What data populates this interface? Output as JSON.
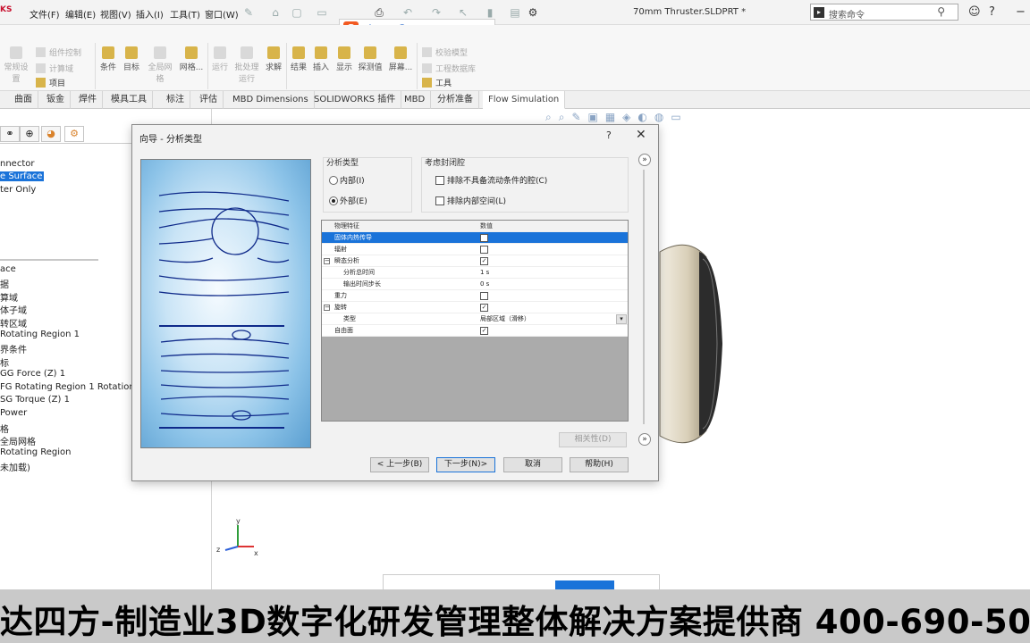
{
  "app": {
    "brand": "KS",
    "document_title": "70mm Thruster.SLDPRT *"
  },
  "menu": [
    "文件(F)",
    "编辑(E)",
    "视图(V)",
    "插入(I)",
    "工具(T)",
    "窗口(W)"
  ],
  "search": {
    "placeholder": "搜索命令"
  },
  "ime": {
    "label": "中"
  },
  "ribbon": {
    "items": [
      {
        "label": "常规设置",
        "dim": true
      },
      {
        "label": "条件",
        "dim": false
      },
      {
        "label": "目标",
        "dim": false
      },
      {
        "label": "全局网格",
        "dim": true
      },
      {
        "label": "网格...",
        "dim": false
      },
      {
        "label": "运行",
        "dim": true
      },
      {
        "label": "批处理运行",
        "dim": true
      },
      {
        "label": "求解",
        "dim": false
      },
      {
        "label": "结果",
        "dim": false
      },
      {
        "label": "插入",
        "dim": false
      },
      {
        "label": "显示",
        "dim": false
      },
      {
        "label": "探测值",
        "dim": false
      },
      {
        "label": "屏幕...",
        "dim": false
      }
    ],
    "rows": [
      "组件控制",
      "计算域",
      "项目",
      "校验模型",
      "工程数据库",
      "工具"
    ]
  },
  "tabs": [
    {
      "label": "曲面",
      "active": false
    },
    {
      "label": "钣金",
      "active": false
    },
    {
      "label": "焊件",
      "active": false
    },
    {
      "label": "模具工具",
      "active": false
    },
    {
      "label": "标注",
      "active": false
    },
    {
      "label": "评估",
      "active": false
    },
    {
      "label": "MBD Dimensions",
      "active": false
    },
    {
      "label": "SOLIDWORKS 插件",
      "active": false
    },
    {
      "label": "MBD",
      "active": false
    },
    {
      "label": "分析准备",
      "active": false
    },
    {
      "label": "Flow Simulation",
      "active": true
    }
  ],
  "tree": {
    "top_items": [
      {
        "label": "nnector",
        "selected": false
      },
      {
        "label": "e Surface",
        "selected": true
      },
      {
        "label": "ter Only",
        "selected": false
      }
    ],
    "items": [
      "ace",
      "据",
      "算域",
      "体子域",
      "转区域",
      "Rotating Region 1",
      "界条件",
      "标",
      "GG Force (Z) 1",
      "FG Rotating Region 1 Rotation",
      "SG Torque (Z) 1",
      "Power",
      "格",
      "全局网格",
      "Rotating Region",
      "未加载)"
    ]
  },
  "wizard": {
    "title": "向导 - 分析类型",
    "help": "?",
    "analysis_type": {
      "label": "分析类型",
      "options": [
        {
          "label": "内部(I)",
          "selected": false
        },
        {
          "label": "外部(E)",
          "selected": true
        }
      ]
    },
    "closed_cavities": {
      "label": "考虑封闭腔",
      "options": [
        {
          "label": "排除不具备流动条件的腔(C)",
          "checked": false
        },
        {
          "label": "排除内部空间(L)",
          "checked": false
        }
      ]
    },
    "table": {
      "header": {
        "name": "物理特征",
        "value": "数值"
      },
      "rows": [
        {
          "name": "固体内热传导",
          "value": "",
          "checkbox": true,
          "checked": false,
          "selected": true,
          "toggle": "",
          "indent": 0,
          "dropdown": false
        },
        {
          "name": "辐射",
          "value": "",
          "checkbox": true,
          "checked": false,
          "selected": false,
          "toggle": "",
          "indent": 0,
          "dropdown": false
        },
        {
          "name": "瞬态分析",
          "value": "",
          "checkbox": true,
          "checked": true,
          "selected": false,
          "toggle": "−",
          "indent": 0,
          "dropdown": false
        },
        {
          "name": "分析总时间",
          "value": "1 s",
          "checkbox": false,
          "checked": false,
          "selected": false,
          "toggle": "",
          "indent": 1,
          "dropdown": false
        },
        {
          "name": "输出时间步长",
          "value": "0 s",
          "checkbox": false,
          "checked": false,
          "selected": false,
          "toggle": "",
          "indent": 1,
          "dropdown": false
        },
        {
          "name": "重力",
          "value": "",
          "checkbox": true,
          "checked": false,
          "selected": false,
          "toggle": "",
          "indent": 0,
          "dropdown": false
        },
        {
          "name": "旋转",
          "value": "",
          "checkbox": true,
          "checked": true,
          "selected": false,
          "toggle": "−",
          "indent": 0,
          "dropdown": false
        },
        {
          "name": "类型",
          "value": "局部区域（滑移）",
          "checkbox": false,
          "checked": false,
          "selected": false,
          "toggle": "",
          "indent": 1,
          "dropdown": true
        },
        {
          "name": "自由面",
          "value": "",
          "checkbox": true,
          "checked": true,
          "selected": false,
          "toggle": "",
          "indent": 0,
          "dropdown": false
        }
      ]
    },
    "dependency_button": "相关性(D)",
    "buttons": {
      "back": "< 上一步(B)",
      "next": "下一步(N)>",
      "cancel": "取消",
      "help": "帮助(H)"
    }
  },
  "triad": {
    "x": "x",
    "y": "y",
    "z": "z"
  },
  "banner": {
    "text": "达四方-制造业3D数字化研发管理整体解决方案提供商   400-690-50"
  },
  "colors": {
    "selection": "#1a73d9",
    "banner_bg": "#c9c9c9",
    "ime_logo": "#f25a22"
  }
}
